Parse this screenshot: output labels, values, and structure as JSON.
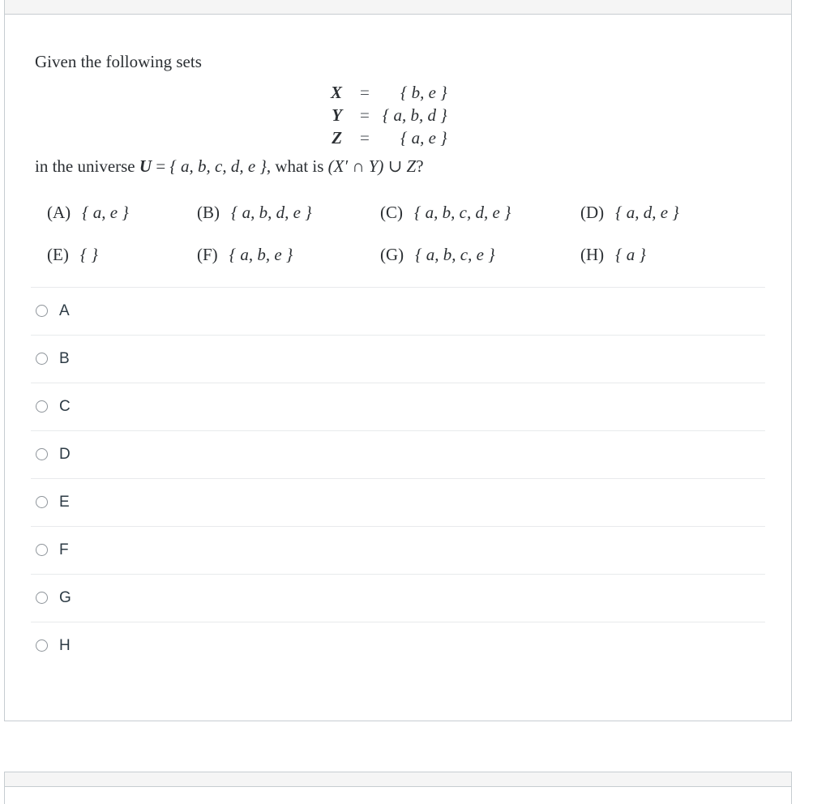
{
  "question": {
    "intro": "Given the following sets",
    "definitions": [
      {
        "var": "X",
        "eq": "=",
        "set": "{ b, e }"
      },
      {
        "var": "Y",
        "eq": "=",
        "set": "{ a, b, d }"
      },
      {
        "var": "Z",
        "eq": "=",
        "set": "{ a, e }"
      }
    ],
    "universe_prefix": "in the universe ",
    "universe_var": "U",
    "universe_eq": " = ",
    "universe_set": "{ a, b, c, d, e }",
    "universe_middle": ", what is ",
    "expression": "(X′ ∩ Y) ∪ Z",
    "universe_suffix": "?",
    "choices": [
      {
        "tag": "(A)",
        "value": "{ a, e }"
      },
      {
        "tag": "(B)",
        "value": "{ a, b, d, e }"
      },
      {
        "tag": "(C)",
        "value": "{ a, b, c, d, e }"
      },
      {
        "tag": "(D)",
        "value": "{ a, d, e }"
      },
      {
        "tag": "(E)",
        "value": "{ }"
      },
      {
        "tag": "(F)",
        "value": "{ a, b, e }"
      },
      {
        "tag": "(G)",
        "value": "{ a, b, c, e }"
      },
      {
        "tag": "(H)",
        "value": "{ a }"
      }
    ]
  },
  "answers": {
    "options": [
      {
        "label": "A",
        "selected": false
      },
      {
        "label": "B",
        "selected": false
      },
      {
        "label": "C",
        "selected": false
      },
      {
        "label": "D",
        "selected": false
      },
      {
        "label": "E",
        "selected": false
      },
      {
        "label": "F",
        "selected": false
      },
      {
        "label": "G",
        "selected": false
      },
      {
        "label": "H",
        "selected": false
      }
    ]
  },
  "colors": {
    "card_border": "#c7cdd1",
    "card_header_bg": "#f5f5f5",
    "divider": "#e8eaec",
    "text": "#2b2f33",
    "label_text": "#2d3b45",
    "radio_border": "#8e949a"
  }
}
